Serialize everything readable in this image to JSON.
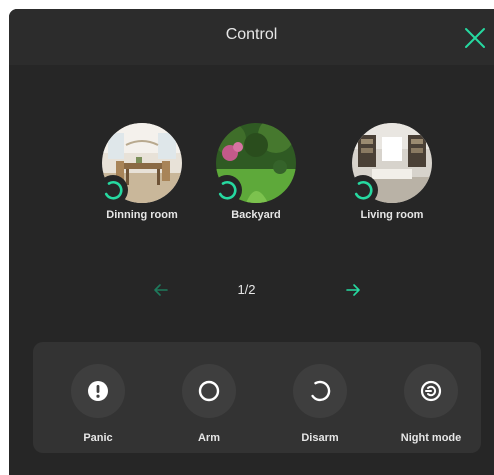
{
  "dialog": {
    "title": "Control"
  },
  "colors": {
    "accent": "#26d9a0",
    "background": "#262626",
    "header": "#2c2c2c",
    "panel": "#333333",
    "button": "#3e3e3e",
    "text": "#e6e6e6"
  },
  "icons": {
    "close": "close-icon",
    "status": "disarm-status-icon",
    "prev": "arrow-left-icon",
    "next": "arrow-right-icon"
  },
  "cameras": [
    {
      "label": "Dinning room",
      "scene": "dining-room-image"
    },
    {
      "label": "Backyard",
      "scene": "backyard-image"
    },
    {
      "label": "Living room",
      "scene": "living-room-image"
    }
  ],
  "pager": {
    "text": "1/2"
  },
  "controls": [
    {
      "label": "Panic",
      "icon": "panic-icon"
    },
    {
      "label": "Arm",
      "icon": "arm-icon"
    },
    {
      "label": "Disarm",
      "icon": "disarm-icon"
    },
    {
      "label": "Night mode",
      "icon": "night-mode-icon"
    }
  ]
}
